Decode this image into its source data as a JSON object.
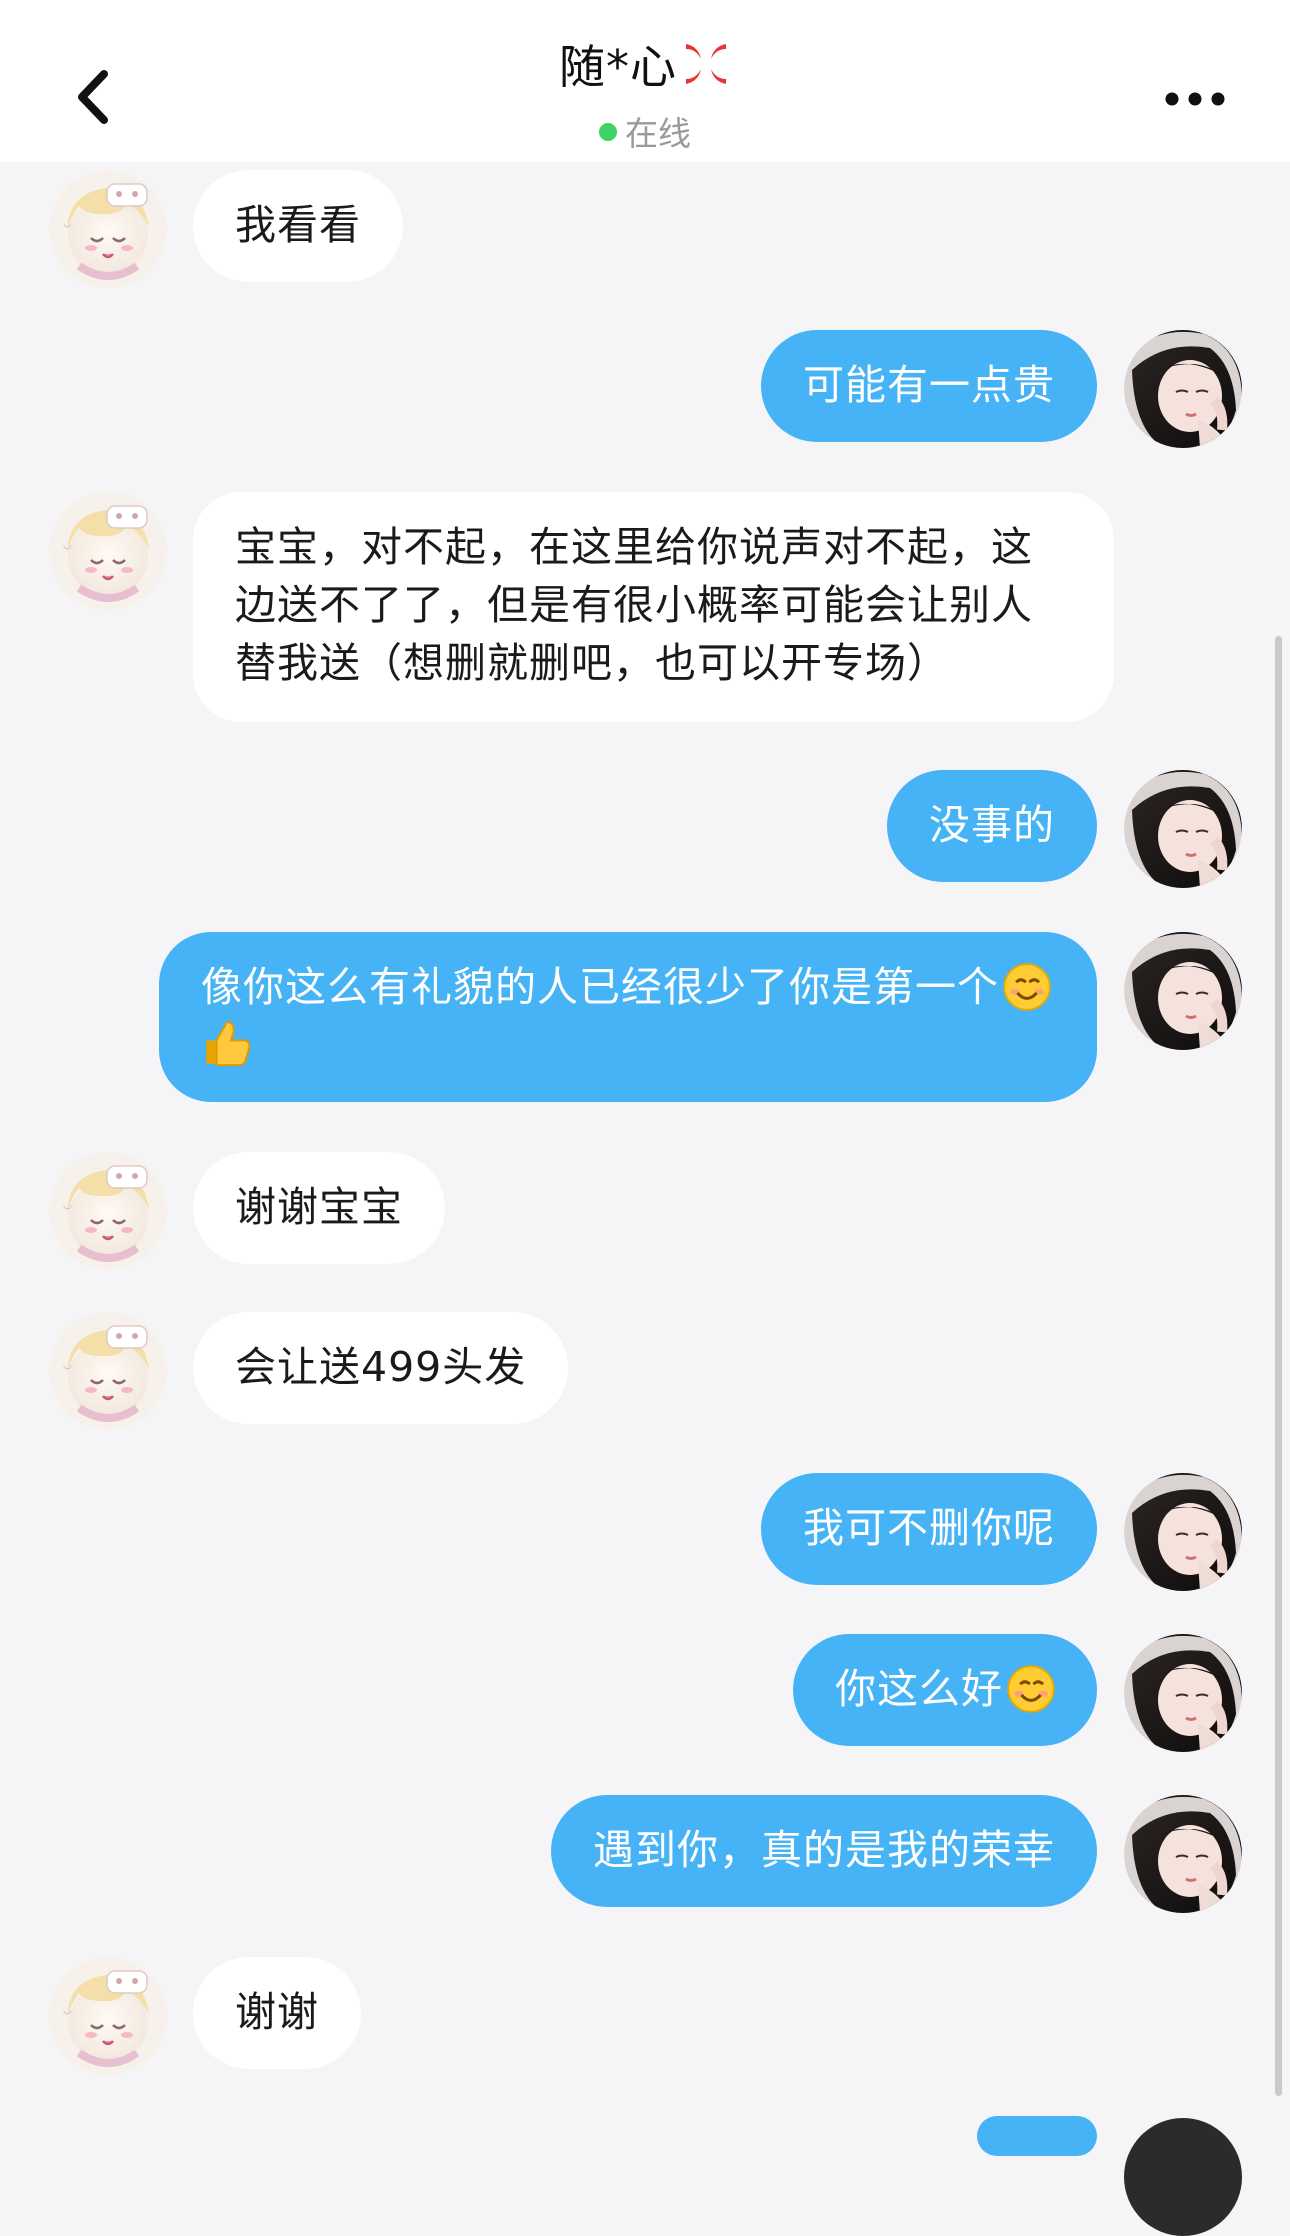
{
  "header": {
    "title": "随*心",
    "title_emoji": "anger-symbol-emoji",
    "status": "在线",
    "status_color": "#3fd163"
  },
  "colors": {
    "outgoing_bubble": "#45b3f6",
    "incoming_bubble": "#ffffff",
    "background": "#f5f4f7"
  },
  "messages": [
    {
      "side": "in",
      "text": "我看看"
    },
    {
      "side": "out",
      "text": "可能有一点贵"
    },
    {
      "side": "in",
      "text": "宝宝，对不起，在这里给你说声对不起，这边送不了了，但是有很小概率可能会让别人替我送（想删就删吧，也可以开专场）"
    },
    {
      "side": "out",
      "text": "没事的"
    },
    {
      "side": "out",
      "text": "像你这么有礼貌的人已经很少了你是第一个",
      "emojis": [
        "smiling-face-emoji",
        "thumbs-up-emoji"
      ]
    },
    {
      "side": "in",
      "text": "谢谢宝宝"
    },
    {
      "side": "in",
      "text": "会让送499头发"
    },
    {
      "side": "out",
      "text": "我可不删你呢"
    },
    {
      "side": "out",
      "text": "你这么好",
      "emojis": [
        "smiling-face-emoji"
      ]
    },
    {
      "side": "out",
      "text": "遇到你，真的是我的荣幸"
    },
    {
      "side": "in",
      "text": "谢谢"
    }
  ]
}
